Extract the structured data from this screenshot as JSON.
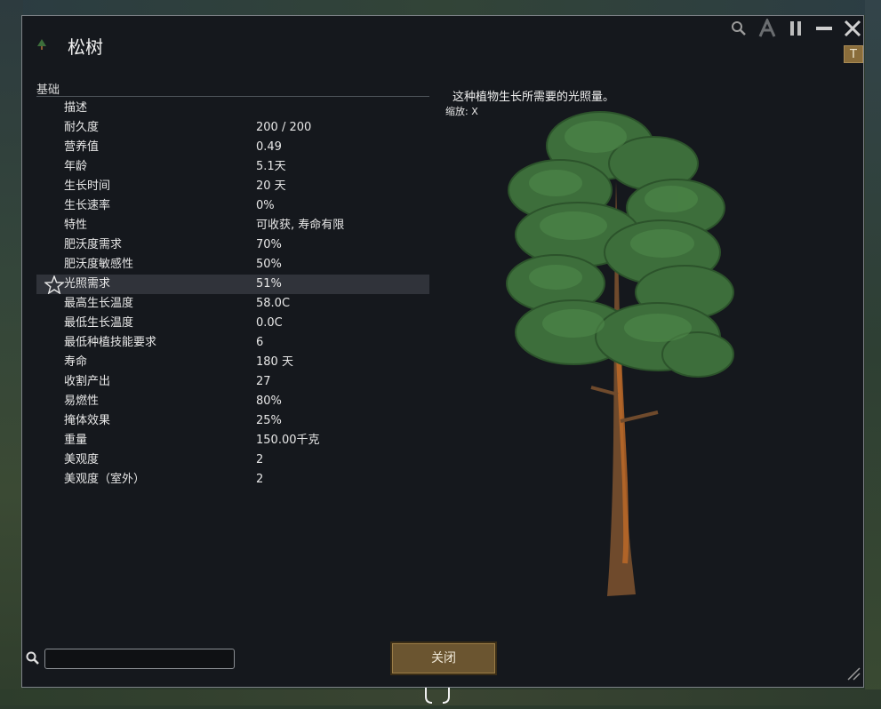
{
  "window": {
    "title": "松树",
    "controls": [
      "search-icon",
      "font-icon",
      "pause-icon",
      "minimize-icon",
      "close-icon"
    ],
    "tab_label": "T"
  },
  "section": {
    "title": "基础"
  },
  "stats": [
    {
      "label": "描述",
      "value": ""
    },
    {
      "label": "耐久度",
      "value": "200 / 200"
    },
    {
      "label": "营养值",
      "value": "0.49"
    },
    {
      "label": "年龄",
      "value": "5.1天"
    },
    {
      "label": "生长时间",
      "value": "20 天"
    },
    {
      "label": "生长速率",
      "value": "0%"
    },
    {
      "label": "特性",
      "value": "可收获, 寿命有限"
    },
    {
      "label": "肥沃度需求",
      "value": "70%"
    },
    {
      "label": "肥沃度敏感性",
      "value": "50%"
    },
    {
      "label": "光照需求",
      "value": "51%"
    },
    {
      "label": "最高生长温度",
      "value": "58.0C"
    },
    {
      "label": "最低生长温度",
      "value": "0.0C"
    },
    {
      "label": "最低种植技能要求",
      "value": "6"
    },
    {
      "label": "寿命",
      "value": "180 天"
    },
    {
      "label": "收割产出",
      "value": "27"
    },
    {
      "label": "易燃性",
      "value": "80%"
    },
    {
      "label": "掩体效果",
      "value": "25%"
    },
    {
      "label": "重量",
      "value": "150.00千克"
    },
    {
      "label": "美观度",
      "value": "2"
    },
    {
      "label": "美观度（室外）",
      "value": "2"
    }
  ],
  "highlighted_stat": "光照需求",
  "description": {
    "text": "这种植物生长所需要的光照量。",
    "zoom": "缩放: X"
  },
  "footer": {
    "search_placeholder": "",
    "close_label": "关闭"
  },
  "colors": {
    "window_bg": "#15181d",
    "button_bg": "#6b5530",
    "foliage": "#3d6e3b",
    "trunk": "#8a5a33"
  }
}
